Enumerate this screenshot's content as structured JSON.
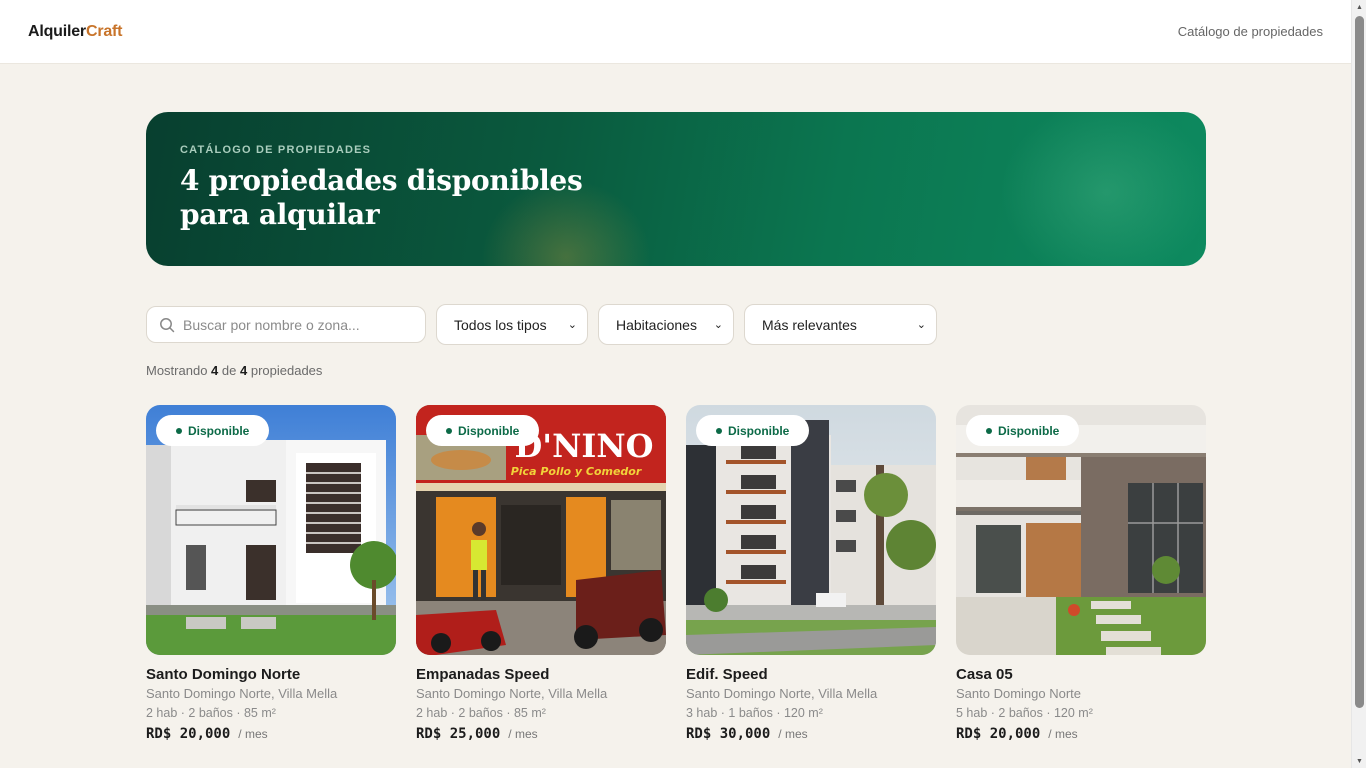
{
  "header": {
    "logo_part1": "Alquiler",
    "logo_part2": "Craft",
    "nav_link": "Catálogo de propiedades"
  },
  "hero": {
    "eyebrow": "CATÁLOGO DE PROPIEDADES",
    "title": "4 propiedades disponibles para alquilar"
  },
  "filters": {
    "search_placeholder": "Buscar por nombre o zona...",
    "type_select": "Todos los tipos",
    "rooms_select": "Habitaciones",
    "sort_select": "Más relevantes"
  },
  "results": {
    "prefix": "Mostrando",
    "shown": "4",
    "middle": "de",
    "total": "4",
    "suffix": "propiedades"
  },
  "colors": {
    "accent": "#c8742a",
    "hero_green": "#0b7650",
    "badge_green": "#0c6a47",
    "background": "#f5f2ec"
  },
  "cards": [
    {
      "badge": "Disponible",
      "image_alt": "two-story white house with dark window shutters",
      "title": "Santo Domingo Norte",
      "location": "Santo Domingo Norte, Villa Mella",
      "specs": "2 hab · 2 baños · 85 m²",
      "price": "RD$ 20,000",
      "period": "/ mes"
    },
    {
      "badge": "Disponible",
      "image_alt": "storefront restaurant with red sign and motorcycles",
      "sign_text": "D'NINO",
      "sign_subtext": "Pica Pollo y Comedor",
      "title": "Empanadas Speed",
      "location": "Santo Domingo Norte, Villa Mella",
      "specs": "2 hab · 2 baños · 85 m²",
      "price": "RD$ 25,000",
      "period": "/ mes"
    },
    {
      "badge": "Disponible",
      "image_alt": "modern apartment building with balconies",
      "title": "Edif. Speed",
      "location": "Santo Domingo Norte, Villa Mella",
      "specs": "3 hab · 1 baños · 120 m²",
      "price": "RD$ 30,000",
      "period": "/ mes"
    },
    {
      "badge": "Disponible",
      "image_alt": "modern house with wood and stone facade",
      "title": "Casa 05",
      "location": "Santo Domingo Norte",
      "specs": "5 hab · 2 baños · 120 m²",
      "price": "RD$ 20,000",
      "period": "/ mes"
    }
  ]
}
